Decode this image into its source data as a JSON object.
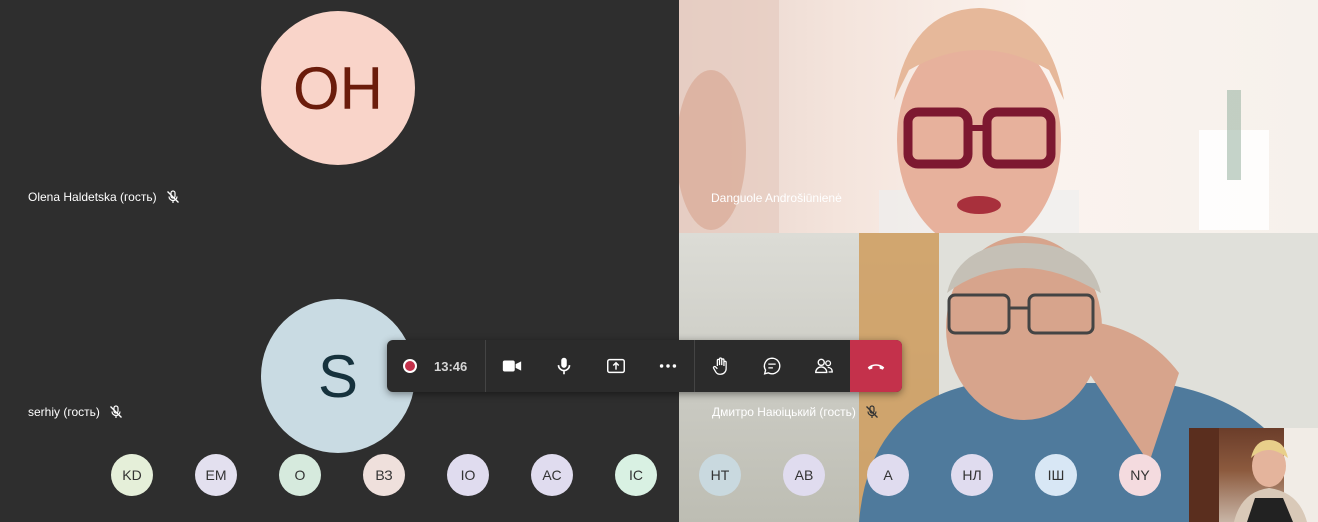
{
  "participants": {
    "olena": {
      "initials": "OH",
      "name": "Olena Haldetska (гость)"
    },
    "danguole": {
      "name": "Danguole Androšiūnienė"
    },
    "serhiy": {
      "initials": "S",
      "name": "serhiy (гость)"
    },
    "dmytro": {
      "name": "Дмитро Наюіцький (гость)"
    }
  },
  "toolbar": {
    "timer": "13:46",
    "icons": [
      "record-icon",
      "camera-icon",
      "microphone-icon",
      "share-screen-icon",
      "more-options-icon",
      "raise-hand-icon",
      "chat-icon",
      "participants-icon",
      "hang-up-icon"
    ]
  },
  "bubbles": [
    {
      "initials": "KD",
      "color": "#e5efd9"
    },
    {
      "initials": "EM",
      "color": "#e3e0ef"
    },
    {
      "initials": "O",
      "color": "#d6eadd"
    },
    {
      "initials": "ВЗ",
      "color": "#efe0dc"
    },
    {
      "initials": "ІО",
      "color": "#e0dcef"
    },
    {
      "initials": "АС",
      "color": "#e0dcef"
    },
    {
      "initials": "ІС",
      "color": "#d9f1e3"
    },
    {
      "initials": "НТ",
      "color": "#c9d9df"
    },
    {
      "initials": "АВ",
      "color": "#e0dcef"
    },
    {
      "initials": "А",
      "color": "#e0dcef"
    },
    {
      "initials": "НЛ",
      "color": "#e0dcef"
    },
    {
      "initials": "ІШ",
      "color": "#d8e7f5"
    },
    {
      "initials": "NY",
      "color": "#f4dbdf"
    }
  ],
  "colors": {
    "hangup": "#c4314b",
    "record": "#c4314b"
  }
}
